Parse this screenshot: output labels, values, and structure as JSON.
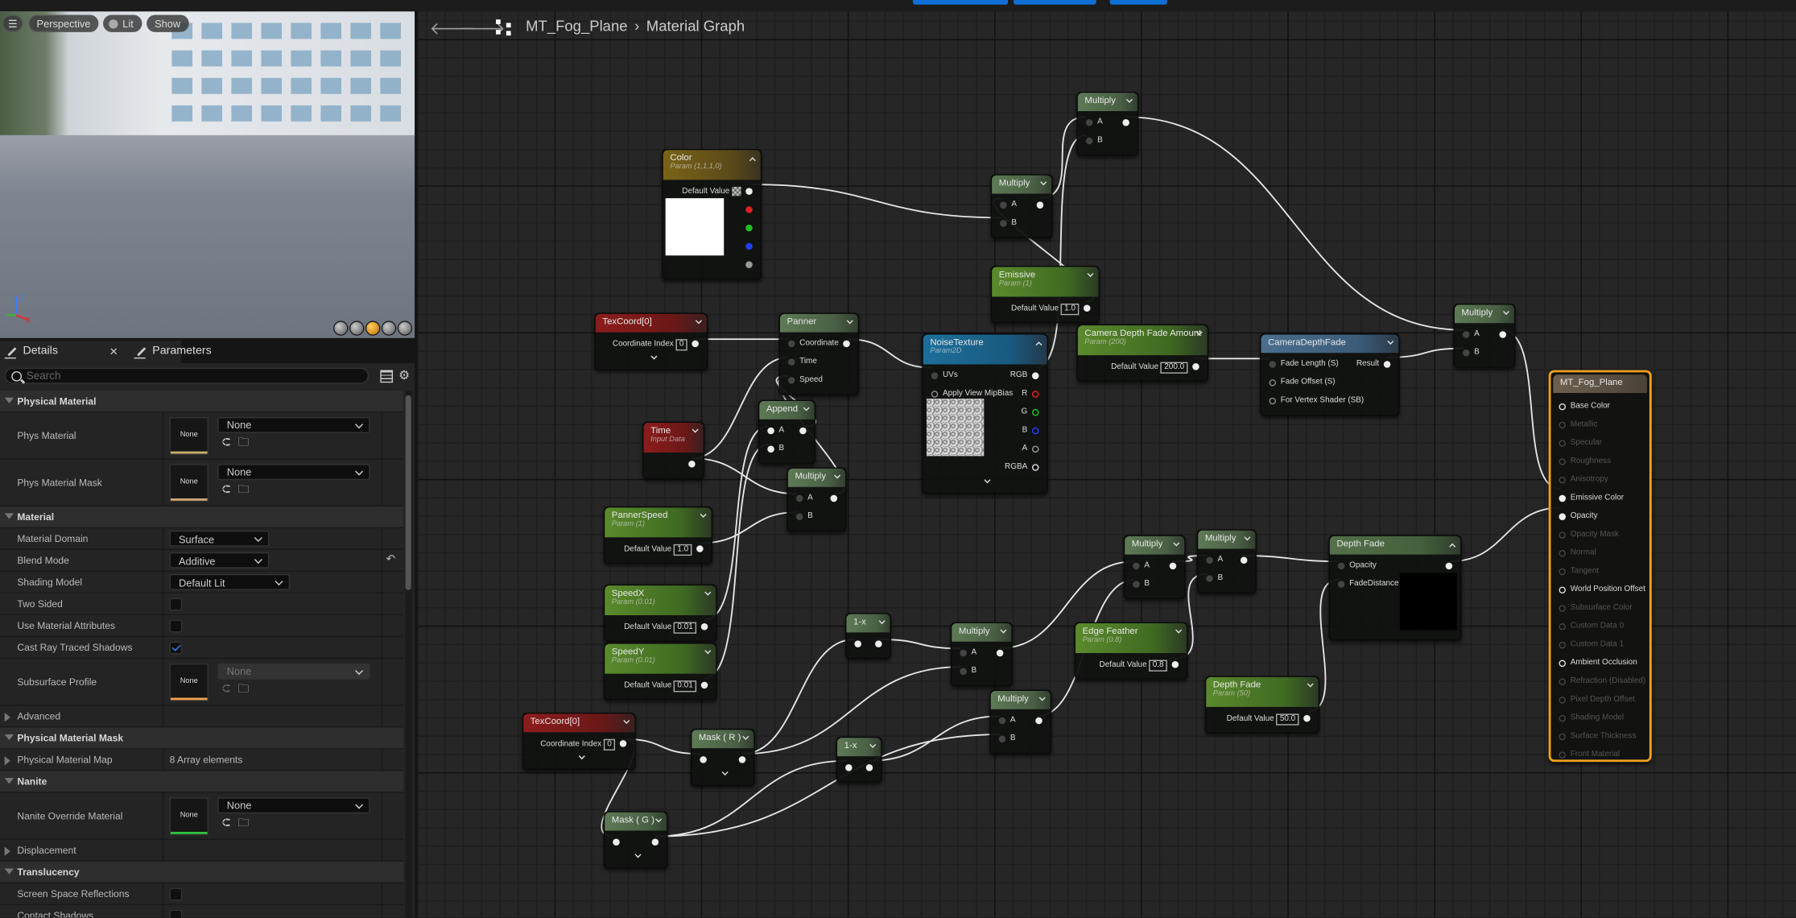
{
  "viewport": {
    "menu_icon": "hamburger-icon",
    "buttons": [
      "Perspective",
      "Lit",
      "Show"
    ],
    "axis": {
      "z": "Z",
      "x": "X"
    }
  },
  "details": {
    "tabs": [
      {
        "label": "Details",
        "closable": true
      },
      {
        "label": "Parameters"
      }
    ],
    "search_placeholder": "Search",
    "rows": [
      {
        "type": "header",
        "label": "Physical Material"
      },
      {
        "type": "asset",
        "label": "Phys Material",
        "thumb": "None",
        "value": "None",
        "bar_color": "#c8b070"
      },
      {
        "type": "asset",
        "label": "Phys Material Mask",
        "thumb": "None",
        "value": "None",
        "bar_color": "#d4a878"
      },
      {
        "type": "header",
        "label": "Material"
      },
      {
        "type": "combo",
        "label": "Material Domain",
        "value": "Surface"
      },
      {
        "type": "combo",
        "label": "Blend Mode",
        "value": "Additive",
        "reset": true
      },
      {
        "type": "combo",
        "label": "Shading Model",
        "value": "Default Lit"
      },
      {
        "type": "check",
        "label": "Two Sided",
        "checked": false
      },
      {
        "type": "check",
        "label": "Use Material Attributes",
        "checked": false
      },
      {
        "type": "check",
        "label": "Cast Ray Traced Shadows",
        "checked": true
      },
      {
        "type": "asset",
        "label": "Subsurface Profile",
        "thumb": "None",
        "value": "None",
        "bar_color": "#f0a050",
        "disabled": true
      },
      {
        "type": "group",
        "label": "Advanced"
      },
      {
        "type": "header",
        "label": "Physical Material Mask"
      },
      {
        "type": "group",
        "label": "Physical Material Map",
        "value": "8 Array elements"
      },
      {
        "type": "header",
        "label": "Nanite"
      },
      {
        "type": "asset",
        "label": "Nanite Override Material",
        "thumb": "None",
        "value": "None",
        "bar_color": "#30c040"
      },
      {
        "type": "group",
        "label": "Displacement"
      },
      {
        "type": "header",
        "label": "Translucency"
      },
      {
        "type": "check",
        "label": "Screen Space Reflections",
        "checked": false
      },
      {
        "type": "check",
        "label": "Contact Shadows",
        "checked": false
      }
    ]
  },
  "graph": {
    "breadcrumb": [
      "MT_Fog_Plane",
      "Material Graph"
    ],
    "nodes": [
      {
        "id": "color",
        "title": "Color",
        "subtitle": "Param (1,1,1,0)",
        "kind": "vector",
        "collapse": "up",
        "rows": [
          {
            "out": "Default Value",
            "swatch": true,
            "outPin": "#eee"
          },
          {
            "outPin": "#e02020"
          },
          {
            "outPin": "#20c020"
          },
          {
            "outPin": "#2040ff"
          },
          {
            "outPin": "#999"
          }
        ],
        "preview_color": "#ffffff"
      },
      {
        "id": "mul1",
        "title": "Multiply",
        "kind": "math",
        "rows": [
          {
            "in": "A",
            "outPin": "#eee"
          },
          {
            "in": "B"
          }
        ]
      },
      {
        "id": "mul2",
        "title": "Multiply",
        "kind": "math",
        "rows": [
          {
            "in": "A",
            "outPin": "#eee"
          },
          {
            "in": "B"
          }
        ]
      },
      {
        "id": "emissive",
        "title": "Emissive",
        "subtitle": "Param (1)",
        "kind": "scalar",
        "rows": [
          {
            "out": "Default Value",
            "value": "1.0",
            "outPin": "#eee"
          }
        ]
      },
      {
        "id": "texcoord1",
        "title": "TexCoord[0]",
        "kind": "input",
        "foot": true,
        "rows": [
          {
            "out": "Coordinate Index",
            "value": "0",
            "outPin": "#eee"
          }
        ]
      },
      {
        "id": "panner",
        "title": "Panner",
        "kind": "math",
        "rows": [
          {
            "in": "Coordinate",
            "outPin": "#eee"
          },
          {
            "in": "Time"
          },
          {
            "in": "Speed"
          }
        ]
      },
      {
        "id": "noise",
        "title": "NoiseTexture",
        "subtitle": "Param2D",
        "kind": "texture",
        "collapse": "up",
        "foot": true,
        "rows": [
          {
            "in": "UVs",
            "out": "RGB",
            "outPin": "#eee"
          },
          {
            "in": "Apply View MipBias",
            "hollowIn": true,
            "out": "R",
            "outPin": "#e02020",
            "hollow": true
          },
          {
            "out": "G",
            "outPin": "#20c020",
            "hollow": true
          },
          {
            "out": "B",
            "outPin": "#2040ff",
            "hollow": true
          },
          {
            "out": "A",
            "outPin": "#999",
            "hollow": true
          },
          {
            "out": "RGBA",
            "outPin": "#ddd",
            "hollow": true
          }
        ]
      },
      {
        "id": "cdfa",
        "title": "Camera Depth Fade Amount",
        "subtitle": "Param (200)",
        "kind": "scalar",
        "rows": [
          {
            "out": "Default Value",
            "value": "200.0",
            "outPin": "#eee"
          }
        ]
      },
      {
        "id": "cdf",
        "title": "CameraDepthFade",
        "kind": "cdf",
        "rows": [
          {
            "in": "Fade Length (S)",
            "out": "Result",
            "outPin": "#eee"
          },
          {
            "in": "Fade Offset (S)",
            "hollowIn": true
          },
          {
            "in": "For Vertex Shader (SB)",
            "hollowIn": true
          }
        ]
      },
      {
        "id": "mul3",
        "title": "Multiply",
        "kind": "math",
        "rows": [
          {
            "in": "A",
            "outPin": "#eee"
          },
          {
            "in": "B"
          }
        ]
      },
      {
        "id": "append",
        "title": "Append",
        "kind": "math",
        "rows": [
          {
            "in": "A",
            "inOn": true,
            "outPin": "#eee"
          },
          {
            "in": "B",
            "inOn": true
          }
        ]
      },
      {
        "id": "time",
        "title": "Time",
        "subtitle": "Input Data",
        "kind": "input",
        "rows": [
          {
            "outPin": "#eee"
          }
        ]
      },
      {
        "id": "mul4",
        "title": "Multiply",
        "kind": "math",
        "rows": [
          {
            "in": "A",
            "outPin": "#eee"
          },
          {
            "in": "B"
          }
        ]
      },
      {
        "id": "pannerspeed",
        "title": "PannerSpeed",
        "subtitle": "Param (1)",
        "kind": "scalar",
        "rows": [
          {
            "out": "Default Value",
            "value": "1.0",
            "outPin": "#eee"
          }
        ]
      },
      {
        "id": "speedx",
        "title": "SpeedX",
        "subtitle": "Param (0.01)",
        "kind": "scalar",
        "rows": [
          {
            "out": "Default Value",
            "value": "0.01",
            "outPin": "#eee"
          }
        ]
      },
      {
        "id": "speedy",
        "title": "SpeedY",
        "subtitle": "Param (0.01)",
        "kind": "scalar",
        "rows": [
          {
            "out": "Default Value",
            "value": "0.01",
            "outPin": "#eee"
          }
        ]
      },
      {
        "id": "mul5",
        "title": "Multiply",
        "kind": "math",
        "rows": [
          {
            "in": "A",
            "outPin": "#eee"
          },
          {
            "in": "B"
          }
        ]
      },
      {
        "id": "mul6",
        "title": "Multiply",
        "kind": "math",
        "rows": [
          {
            "in": "A",
            "outPin": "#eee"
          },
          {
            "in": "B"
          }
        ]
      },
      {
        "id": "depthfade",
        "title": "Depth Fade",
        "kind": "depth",
        "collapse": "up",
        "rows": [
          {
            "in": "Opacity",
            "outPin": "#eee"
          },
          {
            "in": "FadeDistance"
          }
        ],
        "preview_color": "#000000"
      },
      {
        "id": "onex1",
        "title": "1-x",
        "kind": "math",
        "rows": [
          {
            "inOn": true,
            "in": "",
            "outPin": "#eee"
          }
        ]
      },
      {
        "id": "mul7",
        "title": "Multiply",
        "kind": "math",
        "rows": [
          {
            "in": "A",
            "outPin": "#eee"
          },
          {
            "in": "B"
          }
        ]
      },
      {
        "id": "edgefeather",
        "title": "Edge Feather",
        "subtitle": "Param (0.8)",
        "kind": "scalar",
        "rows": [
          {
            "out": "Default Value",
            "value": "0.8",
            "outPin": "#eee"
          }
        ]
      },
      {
        "id": "depthfadeparam",
        "title": "Depth Fade",
        "subtitle": "Param (50)",
        "kind": "scalar",
        "rows": [
          {
            "out": "Default Value",
            "value": "50.0",
            "outPin": "#eee"
          }
        ]
      },
      {
        "id": "mul8",
        "title": "Multiply",
        "kind": "math",
        "rows": [
          {
            "in": "A",
            "outPin": "#eee"
          },
          {
            "in": "B"
          }
        ]
      },
      {
        "id": "texcoord2",
        "title": "TexCoord[0]",
        "kind": "input",
        "foot": true,
        "rows": [
          {
            "out": "Coordinate Index",
            "value": "0",
            "outPin": "#eee"
          }
        ]
      },
      {
        "id": "maskr",
        "title": "Mask ( R )",
        "kind": "math",
        "foot": true,
        "rows": [
          {
            "in": "",
            "inOn": true,
            "outPin": "#eee"
          }
        ]
      },
      {
        "id": "onex2",
        "title": "1-x",
        "kind": "math",
        "rows": [
          {
            "in": "",
            "inOn": true,
            "outPin": "#eee"
          }
        ]
      },
      {
        "id": "maskg",
        "title": "Mask ( G )",
        "kind": "math",
        "foot": true,
        "rows": [
          {
            "in": "",
            "inOn": true,
            "outPin": "#eee"
          }
        ]
      }
    ],
    "result_node": {
      "title": "MT_Fog_Plane",
      "inputs": [
        {
          "label": "Base Color",
          "active": true
        },
        {
          "label": "Metallic",
          "active": false
        },
        {
          "label": "Specular",
          "active": false
        },
        {
          "label": "Roughness",
          "active": false
        },
        {
          "label": "Anisotropy",
          "active": false
        },
        {
          "label": "Emissive Color",
          "active": true,
          "connected": true
        },
        {
          "label": "Opacity",
          "active": true,
          "connected": true
        },
        {
          "label": "Opacity Mask",
          "active": false
        },
        {
          "label": "Normal",
          "active": false
        },
        {
          "label": "Tangent",
          "active": false
        },
        {
          "label": "World Position Offset",
          "active": true
        },
        {
          "label": "Subsurface Color",
          "active": false
        },
        {
          "label": "Custom Data 0",
          "active": false
        },
        {
          "label": "Custom Data 1",
          "active": false
        },
        {
          "label": "Ambient Occlusion",
          "active": true
        },
        {
          "label": "Refraction (Disabled)",
          "active": false
        },
        {
          "label": "Pixel Depth Offset",
          "active": false
        },
        {
          "label": "Shading Model",
          "active": false
        },
        {
          "label": "Surface Thickness",
          "active": false
        },
        {
          "label": "Front Material",
          "active": false
        }
      ]
    }
  },
  "colors": {
    "selection": "#f0a020",
    "accent": "#0f6fd6"
  }
}
